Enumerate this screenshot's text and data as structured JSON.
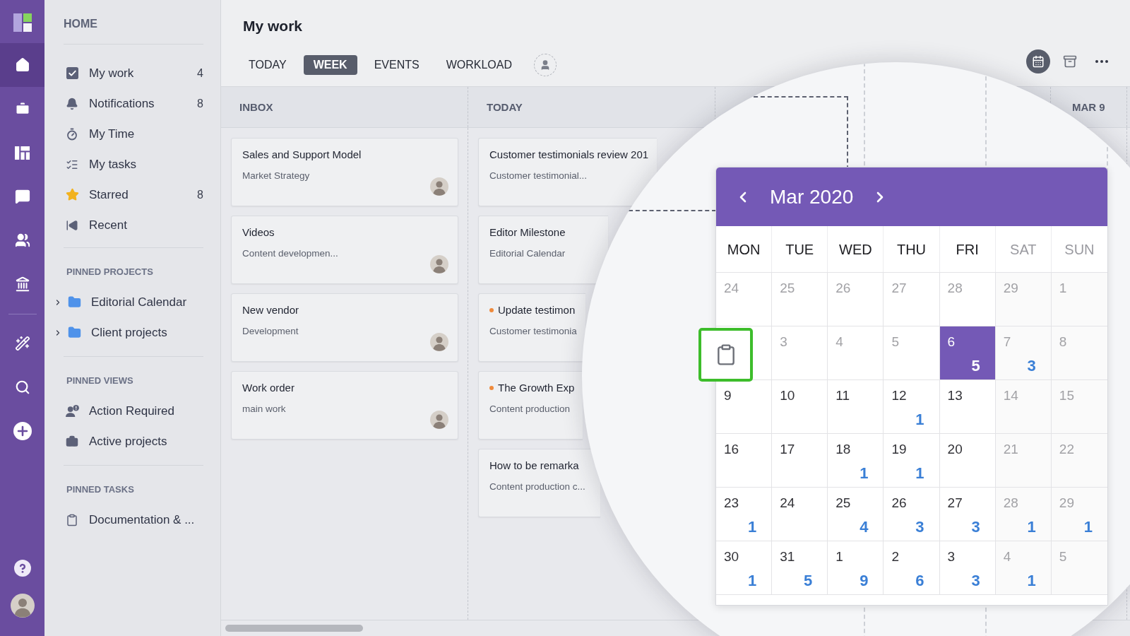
{
  "rail": {
    "items": [
      {
        "selected": true
      },
      {
        "selected": false
      },
      {
        "selected": false
      },
      {
        "selected": false
      },
      {
        "selected": false
      },
      {
        "selected": false
      }
    ]
  },
  "sidebar": {
    "title": "HOME",
    "items": [
      {
        "label": "My work",
        "count": "4"
      },
      {
        "label": "Notifications",
        "count": "8"
      },
      {
        "label": "My Time"
      },
      {
        "label": "My tasks"
      },
      {
        "label": "Starred",
        "count": "8"
      },
      {
        "label": "Recent"
      }
    ],
    "sections": [
      {
        "title": "PINNED PROJECTS",
        "items": [
          {
            "label": "Editorial Calendar",
            "expanded": false
          },
          {
            "label": "Client projects",
            "expanded": false
          }
        ]
      },
      {
        "title": "PINNED VIEWS",
        "items": [
          {
            "label": "Action Required"
          },
          {
            "label": "Active projects"
          }
        ]
      },
      {
        "title": "PINNED TASKS",
        "items": [
          {
            "label": "Documentation & ..."
          }
        ]
      }
    ]
  },
  "header": {
    "title": "My work",
    "tabs": [
      {
        "label": "TODAY",
        "selected": false
      },
      {
        "label": "WEEK",
        "selected": true
      },
      {
        "label": "EVENTS",
        "selected": false
      },
      {
        "label": "WORKLOAD",
        "selected": false
      }
    ],
    "views": [
      {
        "selected": true
      },
      {
        "selected": false
      }
    ]
  },
  "board": {
    "columns": [
      {
        "title": "INBOX",
        "cards": [
          {
            "title": "Sales and Support Model",
            "subtitle": "Market Strategy",
            "avatar": true
          },
          {
            "title": "Videos",
            "subtitle": "Content developmen...",
            "avatar": true
          },
          {
            "title": "New vendor",
            "subtitle": "Development",
            "avatar": true
          },
          {
            "title": "Work order",
            "subtitle": "main work",
            "avatar": true
          }
        ]
      },
      {
        "title": "TODAY",
        "cards": [
          {
            "title": "Customer testimonials review 201",
            "subtitle": "Customer testimonial..."
          },
          {
            "title": "Editor Milestone",
            "subtitle": "Editorial Calendar"
          },
          {
            "title": "Update testimon",
            "subtitle": "Customer testimonia",
            "color": "#ef8a3c"
          },
          {
            "title": "The Growth Exp",
            "subtitle": "Content production",
            "color": "#ef8a3c"
          },
          {
            "title": "How to be remarka",
            "subtitle": "Content production c..."
          }
        ]
      },
      {
        "title": "MAR 9"
      }
    ]
  },
  "calendar": {
    "title": "Mar 2020",
    "weekdays": [
      {
        "label": "MON",
        "weekend": false
      },
      {
        "label": "TUE",
        "weekend": false
      },
      {
        "label": "WED",
        "weekend": false
      },
      {
        "label": "THU",
        "weekend": false
      },
      {
        "label": "FRI",
        "weekend": false
      },
      {
        "label": "SAT",
        "weekend": true
      },
      {
        "label": "SUN",
        "weekend": true
      }
    ],
    "weeks": [
      {
        "days": [
          {
            "kind": "date",
            "day": "24",
            "muted": true,
            "selected": false
          },
          {
            "kind": "date",
            "day": "25",
            "muted": true,
            "selected": false
          },
          {
            "kind": "date",
            "day": "26",
            "muted": true,
            "selected": false
          },
          {
            "kind": "date",
            "day": "27",
            "muted": true,
            "selected": false
          },
          {
            "kind": "date",
            "day": "28",
            "muted": true,
            "selected": false
          },
          {
            "kind": "date",
            "day": "29",
            "muted": true,
            "selected": false
          },
          {
            "kind": "date",
            "day": "1",
            "muted": true,
            "selected": false
          }
        ]
      },
      {
        "days": [
          {
            "kind": "dragged-task"
          },
          {
            "kind": "date",
            "day": "3",
            "muted": true,
            "selected": false
          },
          {
            "kind": "date",
            "day": "4",
            "muted": true,
            "selected": false
          },
          {
            "kind": "date",
            "day": "5",
            "muted": true,
            "selected": false
          },
          {
            "kind": "date",
            "day": "6",
            "selected": true,
            "count": "5"
          },
          {
            "kind": "date",
            "day": "7",
            "muted": true,
            "selected": false,
            "count": "3"
          },
          {
            "kind": "date",
            "day": "8",
            "muted": true,
            "selected": false
          }
        ]
      },
      {
        "days": [
          {
            "kind": "date",
            "day": "9",
            "muted": false,
            "selected": false
          },
          {
            "kind": "date",
            "day": "10",
            "muted": false,
            "selected": false
          },
          {
            "kind": "date",
            "day": "11",
            "muted": false,
            "selected": false
          },
          {
            "kind": "date",
            "day": "12",
            "muted": false,
            "selected": false,
            "count": "1"
          },
          {
            "kind": "date",
            "day": "13",
            "muted": false,
            "selected": false
          },
          {
            "kind": "date",
            "day": "14",
            "muted": true,
            "selected": false
          },
          {
            "kind": "date",
            "day": "15",
            "muted": true,
            "selected": false
          }
        ]
      },
      {
        "days": [
          {
            "kind": "date",
            "day": "16",
            "muted": false,
            "selected": false
          },
          {
            "kind": "date",
            "day": "17",
            "muted": false,
            "selected": false
          },
          {
            "kind": "date",
            "day": "18",
            "muted": false,
            "selected": false,
            "count": "1"
          },
          {
            "kind": "date",
            "day": "19",
            "muted": false,
            "selected": false,
            "count": "1"
          },
          {
            "kind": "date",
            "day": "20",
            "muted": false,
            "selected": false
          },
          {
            "kind": "date",
            "day": "21",
            "muted": true,
            "selected": false
          },
          {
            "kind": "date",
            "day": "22",
            "muted": true,
            "selected": false
          }
        ]
      },
      {
        "days": [
          {
            "kind": "date",
            "day": "23",
            "muted": false,
            "selected": false,
            "count": "1"
          },
          {
            "kind": "date",
            "day": "24",
            "muted": false,
            "selected": false
          },
          {
            "kind": "date",
            "day": "25",
            "muted": false,
            "selected": false,
            "count": "4"
          },
          {
            "kind": "date",
            "day": "26",
            "muted": false,
            "selected": false,
            "count": "3"
          },
          {
            "kind": "date",
            "day": "27",
            "muted": false,
            "selected": false,
            "count": "3"
          },
          {
            "kind": "date",
            "day": "28",
            "muted": true,
            "selected": false,
            "count": "1"
          },
          {
            "kind": "date",
            "day": "29",
            "muted": true,
            "selected": false,
            "count": "1"
          }
        ]
      },
      {
        "days": [
          {
            "kind": "date",
            "day": "30",
            "muted": false,
            "selected": false,
            "count": "1"
          },
          {
            "kind": "date",
            "day": "31",
            "muted": false,
            "selected": false,
            "count": "5"
          },
          {
            "kind": "date",
            "day": "1",
            "muted": false,
            "selected": false,
            "count": "9"
          },
          {
            "kind": "date",
            "day": "2",
            "muted": false,
            "selected": false,
            "count": "6"
          },
          {
            "kind": "date",
            "day": "3",
            "muted": false,
            "selected": false,
            "count": "3"
          },
          {
            "kind": "date",
            "day": "4",
            "muted": true,
            "selected": false,
            "count": "1"
          },
          {
            "kind": "date",
            "day": "5",
            "muted": true,
            "selected": false
          }
        ]
      }
    ]
  }
}
